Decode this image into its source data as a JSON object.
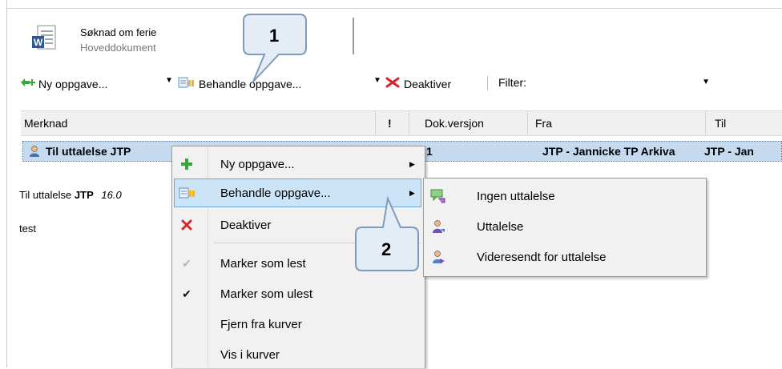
{
  "document": {
    "title": "Søknad om ferie",
    "subtitle": "Hoveddokument",
    "icon": "word-document-icon"
  },
  "toolbar": {
    "new_task": "Ny oppgave...",
    "process_task": "Behandle oppgave...",
    "deactivate": "Deaktiver",
    "filter_label": "Filter:",
    "filter_value": ""
  },
  "grid": {
    "columns": [
      "Merknad",
      "!",
      "Dok.versjon",
      "Fra",
      "Til"
    ],
    "selected_row": {
      "merknad": "Til uttalelse JTP",
      "dok_versjon": "1",
      "fra": "JTP - Jannicke TP Arkiva",
      "til": "JTP - Jan"
    }
  },
  "comment": {
    "prefix": "Til uttalelse",
    "who": "JTP",
    "date": "16.0",
    "text": "test"
  },
  "context_menu": {
    "items": [
      {
        "label": "Ny oppgave...",
        "icon": "plus-icon",
        "submenu": true
      },
      {
        "label": "Behandle oppgave...",
        "icon": "process-task-icon",
        "submenu": true
      },
      {
        "label": "Deaktiver",
        "icon": "red-x-icon",
        "submenu": false
      },
      {
        "label": "Marker som lest",
        "icon": "check-gray-icon",
        "submenu": false
      },
      {
        "label": "Marker som ulest",
        "icon": "check-icon",
        "submenu": false
      },
      {
        "label": "Fjern fra kurver",
        "icon": "",
        "submenu": false
      },
      {
        "label": "Vis i kurver",
        "icon": "",
        "submenu": false
      }
    ]
  },
  "submenu": {
    "items": [
      {
        "label": "Ingen uttalelse",
        "icon": "speech-bubble-icon"
      },
      {
        "label": "Uttalelse",
        "icon": "person-icon"
      },
      {
        "label": "Videresendt for uttalelse",
        "icon": "person-forward-icon"
      }
    ]
  },
  "callouts": {
    "first": "1",
    "second": "2"
  },
  "colors": {
    "selection": "#c5d9ef",
    "menu_highlight": "#cce4f7",
    "callout_fill": "#e4ecf5",
    "callout_border": "#7f9bb9",
    "red_x": "#d8262b",
    "green_plus": "#39a63a"
  }
}
